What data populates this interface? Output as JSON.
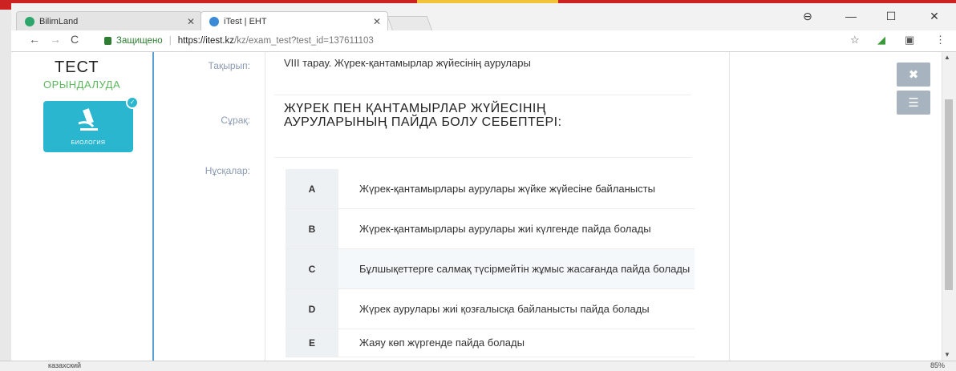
{
  "browser": {
    "tabs": [
      {
        "title": "BilimLand"
      },
      {
        "title": "iTest | ЕНТ"
      }
    ],
    "secure_label": "Защищено",
    "url_host": "https://itest.kz",
    "url_path": "/kz/exam_test?test_id=137611103"
  },
  "left_panel": {
    "title": "ТЕСТ",
    "status": "ОРЫНДАЛУДА",
    "subject": "БИОЛОГИЯ"
  },
  "question": {
    "topic_label": "Тақырып:",
    "topic": "VIII тарау. Жүрек-қантамырлар жүйесінің аурулары",
    "question_label": "Сұрақ:",
    "question_text": "ЖҮРЕК ПЕН ҚАНТАМЫРЛАР ЖҮЙЕСІНІҢ АУРУЛАРЫНЫҢ ПАЙДА БОЛУ СЕБЕПТЕРІ:",
    "options_label": "Нұсқалар:",
    "options": [
      {
        "letter": "A",
        "text": "Жүрек-қантамырлары аурулары жүйке жүйесіне байланысты"
      },
      {
        "letter": "B",
        "text": "Жүрек-қантамырлары аурулары жиі күлгенде пайда болады"
      },
      {
        "letter": "C",
        "text": "Бұлшықеттерге салмақ түсірмейтін жұмыс жасағанда пайда болады"
      },
      {
        "letter": "D",
        "text": "Жүрек аурулары жиі қозғалысқа байланысты пайда болады"
      },
      {
        "letter": "E",
        "text": "Жаяу көп жүргенде пайда болады"
      }
    ]
  },
  "statusbar": {
    "left": "казахский",
    "zoom": "85%"
  }
}
